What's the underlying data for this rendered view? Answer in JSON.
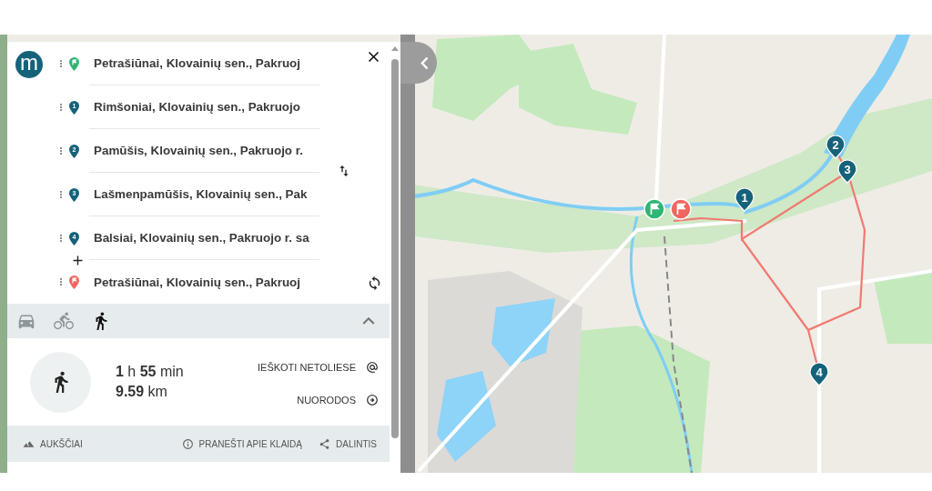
{
  "logo": {
    "text": "m"
  },
  "stops": [
    {
      "kind": "start",
      "address": "Petrašiūnai, Klovainių sen., Pakruoj"
    },
    {
      "kind": "via",
      "number": "1",
      "address": "Rimšoniai, Klovainių sen., Pakruojo"
    },
    {
      "kind": "via",
      "number": "2",
      "address": "Pamūšis, Klovainių sen., Pakruojo r."
    },
    {
      "kind": "via",
      "number": "3",
      "address": "Lašmenpamūšis, Klovainių sen., Pak"
    },
    {
      "kind": "via",
      "number": "4",
      "address": "Balsiai, Klovainių sen., Pakruojo r. sa"
    },
    {
      "kind": "end",
      "address": "Petrašiūnai, Klovainių sen., Pakruoj"
    }
  ],
  "travel_modes": [
    {
      "kind": "car",
      "selected": false
    },
    {
      "kind": "bike",
      "selected": false
    },
    {
      "kind": "walk",
      "selected": true
    }
  ],
  "summary": {
    "duration": "**1** h **55** min",
    "distance": "**9.59** km"
  },
  "actions": [
    {
      "kind": "nearby",
      "label": "IEŠKOTI NETOLIESE"
    },
    {
      "kind": "directions",
      "label": "NUORODOS"
    }
  ],
  "footer": [
    {
      "kind": "elevation",
      "label": "AUKŠČIAI"
    },
    {
      "kind": "report",
      "label": "PRANEŠTI APIE KLAIDĄ"
    },
    {
      "kind": "share",
      "label": "DALINTIS"
    }
  ],
  "map": {
    "kind": "picture",
    "markers": [
      {
        "kind": "start"
      },
      {
        "kind": "end"
      },
      {
        "kind": "via",
        "number": "1"
      },
      {
        "kind": "via",
        "number": "2"
      },
      {
        "kind": "via",
        "number": "3"
      },
      {
        "kind": "via",
        "number": "4"
      }
    ]
  }
}
